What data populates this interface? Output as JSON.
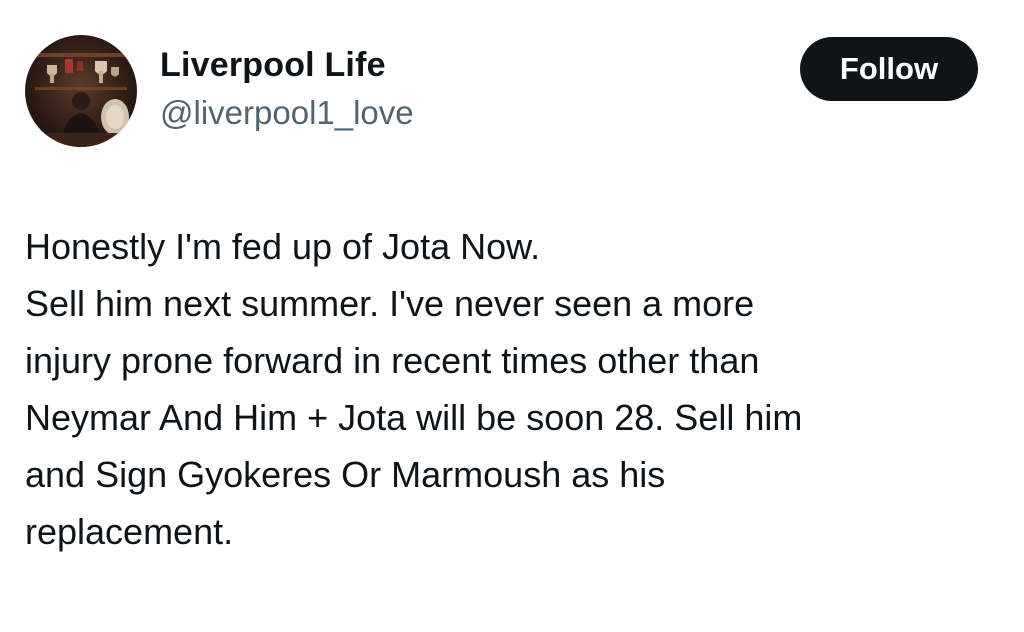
{
  "author": {
    "display_name": "Liverpool Life",
    "handle": "@liverpool1_love",
    "avatar_icon": "profile-photo-icon"
  },
  "follow_button": {
    "label": "Follow",
    "background": "#0f1419",
    "text_color": "#ffffff"
  },
  "tweet": {
    "lines": [
      "Honestly I'm fed up of Jota Now.",
      "Sell him next summer. I've never seen a more",
      "injury prone forward in recent times other than",
      "Neymar And Him + Jota will be soon 28. Sell him",
      "and Sign Gyokeres Or Marmoush as his",
      "replacement."
    ]
  },
  "colors": {
    "text_primary": "#0f1419",
    "text_secondary": "#536471",
    "background": "#ffffff"
  }
}
